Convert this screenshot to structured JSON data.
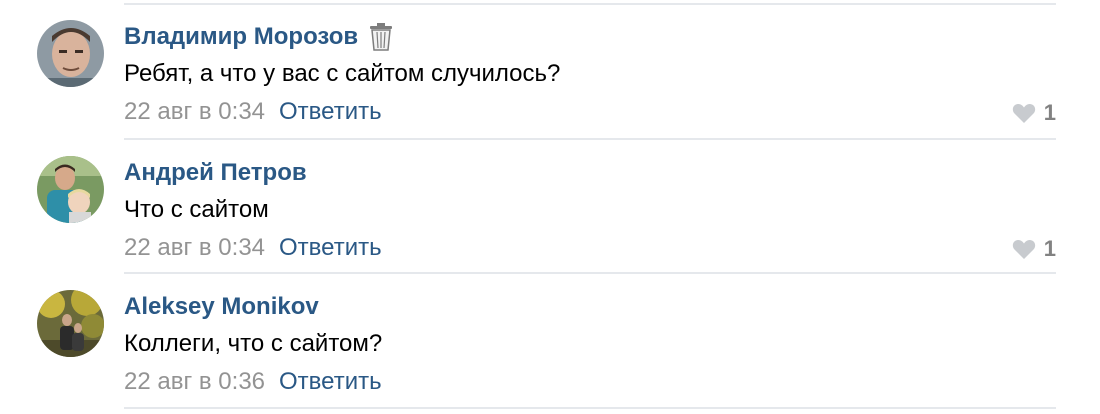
{
  "comments": [
    {
      "author": "Владимир Морозов",
      "text": "Ребят, а что у вас с сайтом случилось?",
      "date": "22 авг в 0:34",
      "reply_label": "Ответить",
      "likes": "1"
    },
    {
      "author": "Андрей Петров",
      "text": "Что с сайтом",
      "date": "22 авг в 0:34",
      "reply_label": "Ответить",
      "likes": "1"
    },
    {
      "author": "Aleksey Monikov",
      "text": "Коллеги, что с сайтом?",
      "date": "22 авг в 0:36",
      "reply_label": "Ответить"
    }
  ],
  "colors": {
    "link": "#2a5885",
    "meta": "#939393",
    "divider": "#e5e8ec"
  }
}
